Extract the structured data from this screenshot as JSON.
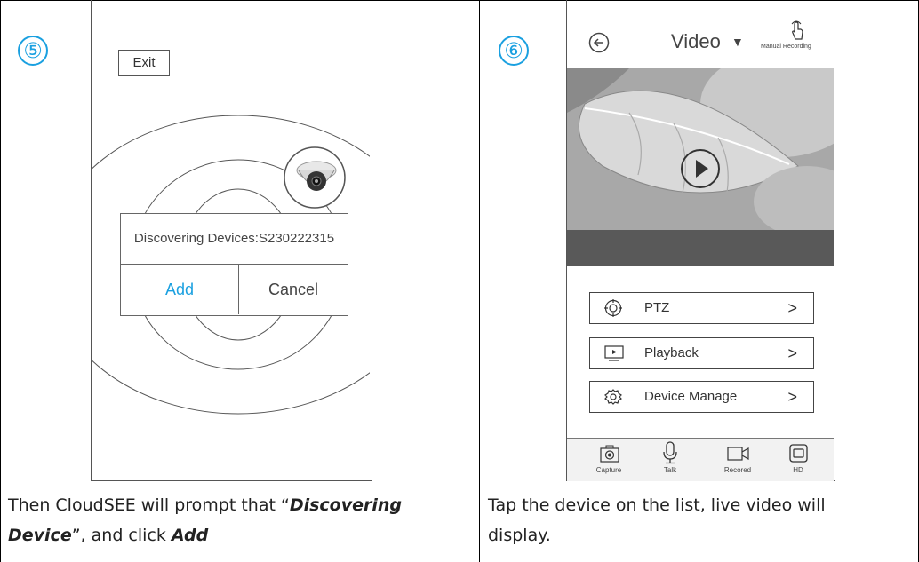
{
  "steps": {
    "left": {
      "number": "⑤",
      "exit_label": "Exit",
      "dialog": {
        "title": "Discovering Devices:S230222315",
        "add_label": "Add",
        "cancel_label": "Cancel"
      },
      "caption_parts": [
        "Then CloudSEE will prompt that “",
        "Discovering Device",
        "”, and click ",
        "Add"
      ]
    },
    "right": {
      "number": "⑥",
      "header": {
        "title": "Video",
        "dropdown_glyph": "▼",
        "manual_recording": "Manual Recording"
      },
      "menu": [
        {
          "label": "PTZ",
          "icon": "ptz-target-icon"
        },
        {
          "label": "Playback",
          "icon": "playback-screen-icon"
        },
        {
          "label": "Device Manage",
          "icon": "gear-icon"
        }
      ],
      "toolbar": [
        {
          "label": "Capture",
          "icon": "camera-icon"
        },
        {
          "label": "Talk",
          "icon": "microphone-icon"
        },
        {
          "label": "Recored",
          "icon": "video-camera-icon"
        },
        {
          "label": "HD",
          "icon": "hd-square-icon"
        }
      ],
      "caption": "Tap the device on the list, live video will display."
    }
  },
  "colors": {
    "accent": "#1aa0e0",
    "gray_bar": "#595959"
  }
}
